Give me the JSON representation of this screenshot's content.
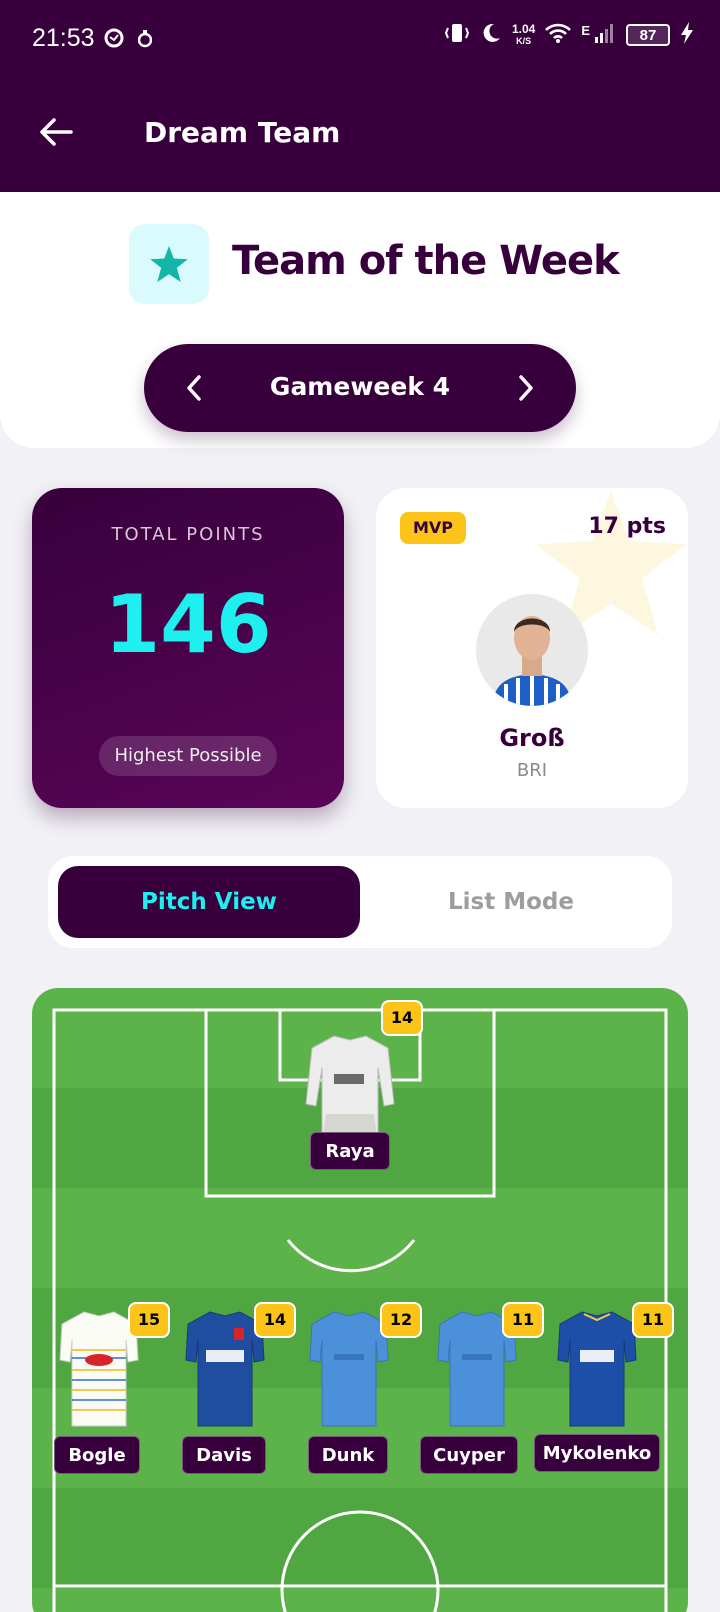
{
  "status_bar": {
    "time": "21:53",
    "net_speed": "1.04",
    "net_speed_unit": "K/S",
    "network_type": "E",
    "battery": "87"
  },
  "app_bar": {
    "title": "Dream Team"
  },
  "hero": {
    "title": "Team of the Week",
    "gameweek_label": "Gameweek 4",
    "icon": "star-icon"
  },
  "points_card": {
    "label": "TOTAL POINTS",
    "value": "146",
    "tag": "Highest Possible"
  },
  "mvp_card": {
    "badge": "MVP",
    "points": "17 pts",
    "name": "Groß",
    "club": "BRI"
  },
  "view_toggle": {
    "active": "Pitch View",
    "inactive": "List Mode"
  },
  "colors": {
    "primary": "#37003c",
    "accent": "#1ef0f0",
    "highlight": "#fcc419",
    "pitch": "#5cb34a"
  },
  "players": [
    {
      "name": "Raya",
      "points": "14",
      "kit": "arsenal-gk-kit"
    },
    {
      "name": "Bogle",
      "points": "15",
      "kit": "leeds-kit"
    },
    {
      "name": "Davis",
      "points": "14",
      "kit": "ipswich-kit"
    },
    {
      "name": "Dunk",
      "points": "12",
      "kit": "brighton-kit"
    },
    {
      "name": "Cuyper",
      "points": "11",
      "kit": "brighton-kit"
    },
    {
      "name": "Mykolenko",
      "points": "11",
      "kit": "everton-kit"
    }
  ]
}
